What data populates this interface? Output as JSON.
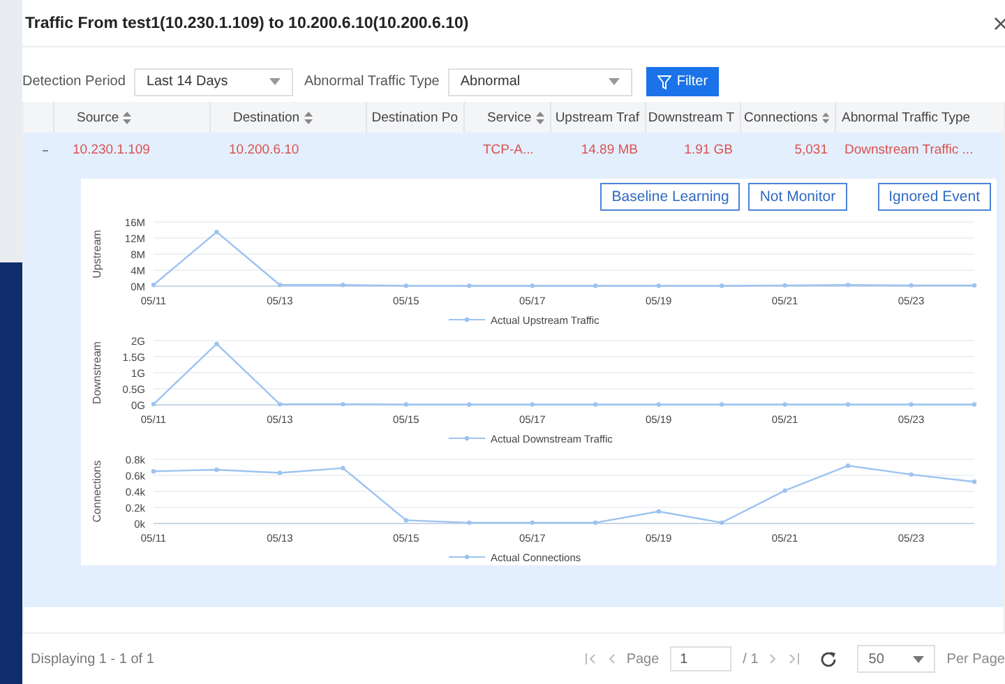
{
  "window": {
    "title": "Traffic From test1(10.230.1.109) to 10.200.6.10(10.200.6.10)"
  },
  "filters": [
    {
      "label": "Detection Period",
      "value": "Last 14 Days"
    },
    {
      "label": "Abnormal Traffic Type",
      "value": "Abnormal"
    }
  ],
  "filter_button": "Filter",
  "table": {
    "columns": [
      {
        "label": "Source",
        "sortable": true
      },
      {
        "label": "Destination",
        "sortable": true
      },
      {
        "label": "Destination Po",
        "sortable": false
      },
      {
        "label": "Service",
        "sortable": true
      },
      {
        "label": "Upstream Traf",
        "sortable": false
      },
      {
        "label": "Downstream T",
        "sortable": false
      },
      {
        "label": "Connections",
        "sortable": true
      },
      {
        "label": "Abnormal Traffic Type",
        "sortable": false
      }
    ],
    "rows": [
      {
        "expanded": true,
        "cells": [
          "10.230.1.109",
          "10.200.6.10",
          "",
          "TCP-A...",
          "14.89 MB",
          "1.91 GB",
          "5,031",
          "Downstream Traffic ..."
        ]
      }
    ]
  },
  "detail": {
    "buttons": [
      "Baseline Learning",
      "Not Monitor",
      "Ignored Event"
    ],
    "charts": [
      {
        "chart_data": {
          "type": "line",
          "ylabel": "Upstream",
          "grid": true,
          "categories": [
            "05/11",
            null,
            "05/13",
            null,
            "05/15",
            null,
            "05/17",
            null,
            "05/19",
            null,
            "05/21",
            null,
            "05/23",
            null
          ],
          "series": [
            {
              "name": "Actual Upstream Traffic",
              "color": "#9cc3f0",
              "marker": "circle",
              "values": [
                0.3,
                13.5,
                0.3,
                0.3,
                0.1,
                0.1,
                0.1,
                0.1,
                0.1,
                0.1,
                0.2,
                0.3,
                0.2,
                0.2
              ]
            }
          ],
          "ylim": [
            0,
            16
          ],
          "yticks": [
            {
              "value": 0,
              "label": "0M"
            },
            {
              "value": 4,
              "label": "4M"
            },
            {
              "value": 8,
              "label": "8M"
            },
            {
              "value": 12,
              "label": "12M"
            },
            {
              "value": 16,
              "label": "16M"
            }
          ]
        }
      },
      {
        "chart_data": {
          "type": "line",
          "ylabel": "Downstream",
          "grid": true,
          "categories": [
            "05/11",
            null,
            "05/13",
            null,
            "05/15",
            null,
            "05/17",
            null,
            "05/19",
            null,
            "05/21",
            null,
            "05/23",
            null
          ],
          "series": [
            {
              "name": "Actual Downstream Traffic",
              "color": "#9cc3f0",
              "marker": "circle",
              "values": [
                0.02,
                1.9,
                0.02,
                0.02,
                0.01,
                0.01,
                0.01,
                0.01,
                0.01,
                0.01,
                0.01,
                0.01,
                0.01,
                0.01
              ]
            }
          ],
          "ylim": [
            0,
            2
          ],
          "yticks": [
            {
              "value": 0,
              "label": "0G"
            },
            {
              "value": 0.5,
              "label": "0.5G"
            },
            {
              "value": 1,
              "label": "1G"
            },
            {
              "value": 1.5,
              "label": "1.5G"
            },
            {
              "value": 2,
              "label": "2G"
            }
          ]
        }
      },
      {
        "chart_data": {
          "type": "line",
          "ylabel": "Connections",
          "grid": true,
          "categories": [
            "05/11",
            null,
            "05/13",
            null,
            "05/15",
            null,
            "05/17",
            null,
            "05/19",
            null,
            "05/21",
            null,
            "05/23",
            null
          ],
          "series": [
            {
              "name": "Actual Connections",
              "color": "#9cc3f0",
              "marker": "circle",
              "values": [
                0.65,
                0.67,
                0.63,
                0.69,
                0.04,
                0.01,
                0.01,
                0.01,
                0.15,
                0.01,
                0.41,
                0.72,
                0.61,
                0.52
              ]
            }
          ],
          "ylim": [
            0,
            0.8
          ],
          "yticks": [
            {
              "value": 0,
              "label": "0k"
            },
            {
              "value": 0.2,
              "label": "0.2k"
            },
            {
              "value": 0.4,
              "label": "0.4k"
            },
            {
              "value": 0.6,
              "label": "0.6k"
            },
            {
              "value": 0.8,
              "label": "0.8k"
            }
          ]
        }
      }
    ]
  },
  "pager": {
    "summary": "Displaying 1 - 1 of 1",
    "page_label": "Page",
    "page": "1",
    "total": "/ 1",
    "page_size": "50",
    "per_page": "Per Page",
    "first_disabled": true,
    "prev_disabled": true,
    "next_disabled": true,
    "last_disabled": true
  }
}
